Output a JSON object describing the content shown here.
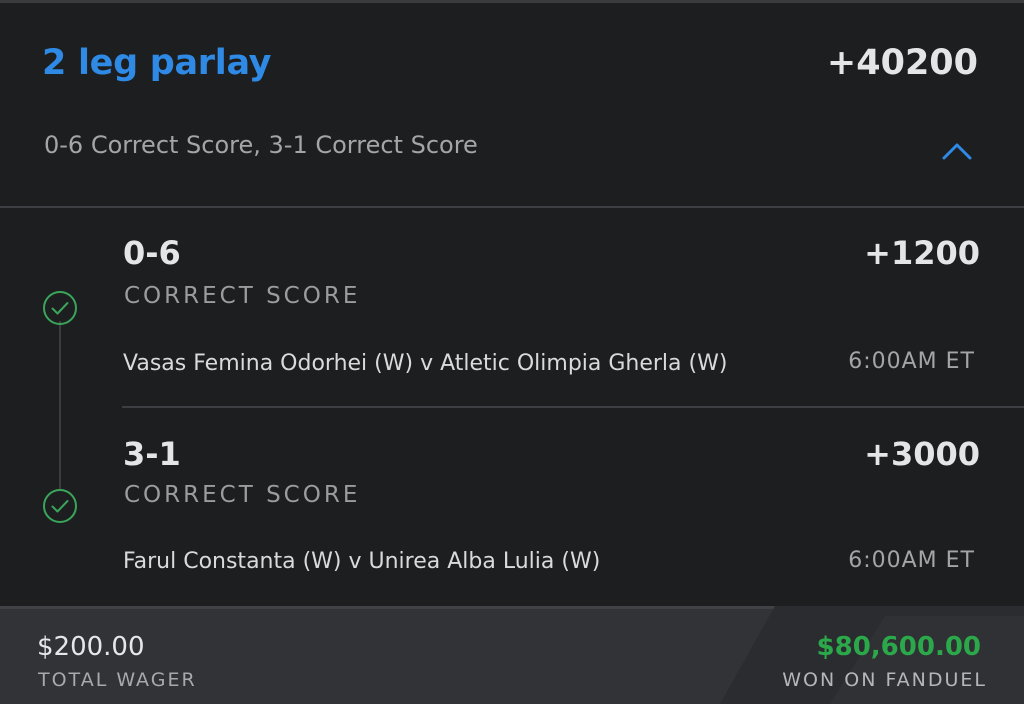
{
  "colors": {
    "accent": "#2f8ae6",
    "win": "#2ba84a",
    "check": "#3aa55a",
    "background": "#1d1e20",
    "footer_bg": "#323336"
  },
  "parlay": {
    "title": "2 leg parlay",
    "odds": "+40200",
    "summary": "0-6 Correct Score, 3-1 Correct Score",
    "toggle_icon": "chevron-up-icon"
  },
  "legs": [
    {
      "score": "0-6",
      "odds": "+1200",
      "market": "CORRECT SCORE",
      "matchup": "Vasas Femina Odorhei (W) v Atletic Olimpia Gherla (W)",
      "time": "6:00AM ET",
      "status_icon": "check-circle-icon"
    },
    {
      "score": "3-1",
      "odds": "+3000",
      "market": "CORRECT SCORE",
      "matchup": "Farul Constanta (W) v Unirea Alba Lulia (W)",
      "time": "6:00AM ET",
      "status_icon": "check-circle-icon"
    }
  ],
  "footer": {
    "wager_amount": "$200.00",
    "wager_label": "TOTAL WAGER",
    "won_amount": "$80,600.00",
    "won_label": "WON ON FANDUEL"
  }
}
